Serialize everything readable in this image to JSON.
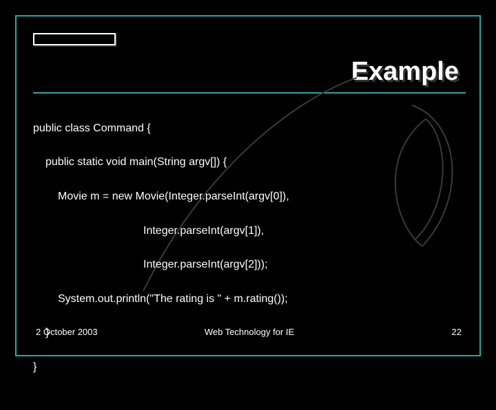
{
  "title": "Example",
  "code": {
    "l1": "public class Command {",
    "l2": "public static void main(String argv[]) {",
    "l3": "Movie m = new Movie(Integer.parseInt(argv[0]),",
    "l4": "Integer.parseInt(argv[1]),",
    "l5": "Integer.parseInt(argv[2]));",
    "l6": "System.out.println(\"The rating is \" + m.rating());",
    "l7": "}",
    "l8": "}"
  },
  "footer": {
    "date": "2 October 2003",
    "center": "Web Technology for IE",
    "page": "22"
  }
}
